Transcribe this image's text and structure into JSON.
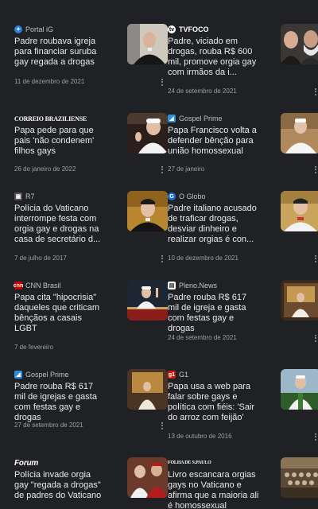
{
  "articles": [
    {
      "source": "Portal iG",
      "icon": "portal-ig-logo",
      "title": "Padre roubava igreja para financiar suruba gay regada a drogas",
      "date": "11 de dezembro de 2021"
    },
    {
      "source": "TVFOCO",
      "icon": "tv-foco-logo",
      "title": "Padre, viciado em drogas, rouba R$ 600 mil, promove orgia gay com irmãos da i...",
      "date": "24 de setembro de 2021"
    },
    {
      "source": "CORREIO BRAZILIENSE",
      "icon": "correio-braziliense-logo",
      "title": "Papa pede para que pais 'não condenem' filhos gays",
      "date": "26 de janeiro de 2022"
    },
    {
      "source": "Gospel Prime",
      "icon": "gospel-prime-logo",
      "title": "Papa Francisco volta a defender bênção para união homossexual",
      "date": "27 de janeiro"
    },
    {
      "source": "R7",
      "icon": "r7-logo",
      "title": "Polícia do Vaticano interrompe festa com orgia gay e drogas na casa de secretário d...",
      "date": "7 de julho de 2017"
    },
    {
      "source": "O Globo",
      "icon": "o-globo-logo",
      "title": "Padre italiano acusado de traficar drogas, desviar dinheiro e realizar orgias é con...",
      "date": "10 de dezembro de 2021"
    },
    {
      "source": "CNN Brasil",
      "icon": "cnn-brasil-logo",
      "title": "Papa cita \"hipocrisia\" daqueles que criticam bênçãos a casais LGBT",
      "date": "7 de fevereiro"
    },
    {
      "source": "Pleno.News",
      "icon": "pleno-news-logo",
      "title": "Padre rouba R$ 617 mil de igreja e gasta com festas gay e drogas",
      "date": "24 de setembro de 2021"
    },
    {
      "source": "Gospel Prime",
      "icon": "gospel-prime-logo",
      "title": "Padre rouba R$ 617 mil de igrejas e gasta com festas gay e drogas",
      "date": "27 de setembro de 2021"
    },
    {
      "source": "G1",
      "icon": "g1-logo",
      "title": "Papa usa a web para falar sobre gays e política com fiéis: 'Sair do arroz com feijão'",
      "date": "13 de outubro de 2016"
    },
    {
      "source": "Forum",
      "icon": "forum-logo",
      "title": "Polícia invade orgia gay \"regada a drogas\" de padres do Vaticano",
      "date": ""
    },
    {
      "source": "FOLHA DE S.PAULO",
      "icon": "folha-logo",
      "title": "Livro escancara orgias gays no Vaticano e afirma que a maioria ali é homossexual",
      "date": ""
    }
  ],
  "colors": {
    "background": "#202124",
    "text": "#e8eaed",
    "meta": "#9aa0a6"
  }
}
